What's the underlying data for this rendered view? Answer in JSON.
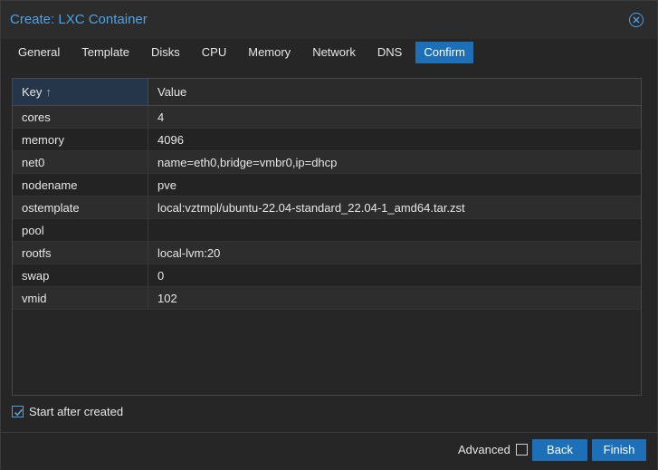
{
  "dialog": {
    "title": "Create: LXC Container"
  },
  "tabs": [
    {
      "label": "General"
    },
    {
      "label": "Template"
    },
    {
      "label": "Disks"
    },
    {
      "label": "CPU"
    },
    {
      "label": "Memory"
    },
    {
      "label": "Network"
    },
    {
      "label": "DNS"
    },
    {
      "label": "Confirm",
      "active": true
    }
  ],
  "grid": {
    "columns": {
      "key": "Key",
      "value": "Value"
    },
    "sort_indicator": "↑",
    "rows": [
      {
        "key": "cores",
        "value": "4"
      },
      {
        "key": "memory",
        "value": "4096"
      },
      {
        "key": "net0",
        "value": "name=eth0,bridge=vmbr0,ip=dhcp"
      },
      {
        "key": "nodename",
        "value": "pve"
      },
      {
        "key": "ostemplate",
        "value": "local:vztmpl/ubuntu-22.04-standard_22.04-1_amd64.tar.zst"
      },
      {
        "key": "pool",
        "value": ""
      },
      {
        "key": "rootfs",
        "value": "local-lvm:20"
      },
      {
        "key": "swap",
        "value": "0"
      },
      {
        "key": "vmid",
        "value": "102"
      }
    ]
  },
  "start_after_created": {
    "label": "Start after created",
    "checked": true
  },
  "footer": {
    "advanced_label": "Advanced",
    "advanced_checked": false,
    "back_label": "Back",
    "finish_label": "Finish"
  },
  "colors": {
    "accent": "#1d6fb8",
    "title": "#4aa3e8"
  },
  "icons": {
    "close": "close-circle-icon",
    "check": "checkmark-icon"
  }
}
